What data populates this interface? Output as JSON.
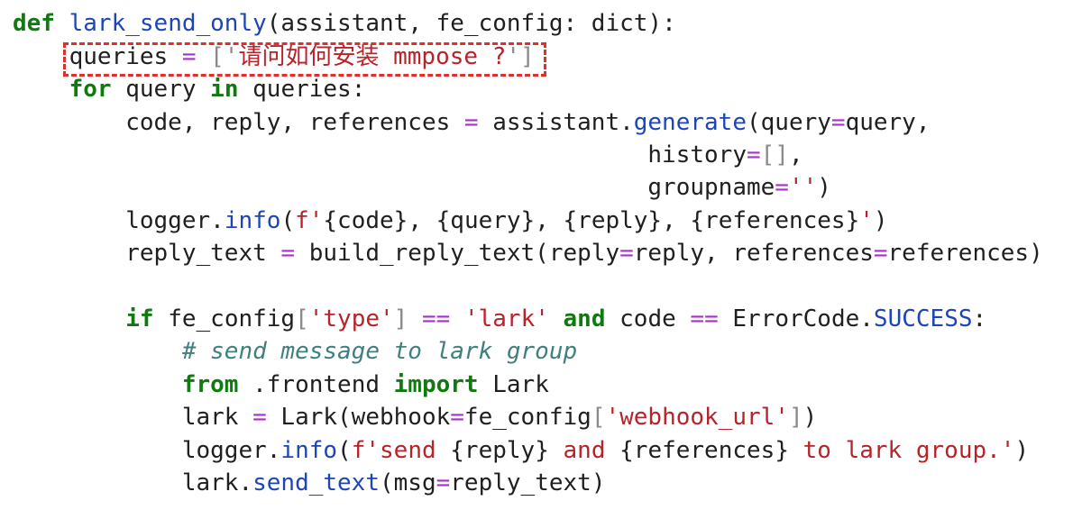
{
  "code": {
    "lines": [
      [
        {
          "t": "def",
          "c": "kw"
        },
        {
          "t": " "
        },
        {
          "t": "lark_send_only",
          "c": "fn"
        },
        {
          "t": "(assistant, fe_config: dict):"
        }
      ],
      [
        {
          "t": "    queries "
        },
        {
          "t": "=",
          "c": "op"
        },
        {
          "t": " "
        },
        {
          "t": "['",
          "c": "br"
        },
        {
          "t": "请问如何安装 mmpose ?",
          "c": "str"
        },
        {
          "t": "']",
          "c": "br"
        }
      ],
      [
        {
          "t": "    "
        },
        {
          "t": "for",
          "c": "kw"
        },
        {
          "t": " query "
        },
        {
          "t": "in",
          "c": "kw"
        },
        {
          "t": " queries:"
        }
      ],
      [
        {
          "t": "        code, reply, references "
        },
        {
          "t": "=",
          "c": "op"
        },
        {
          "t": " assistant."
        },
        {
          "t": "generate",
          "c": "fn"
        },
        {
          "t": "(query"
        },
        {
          "t": "=",
          "c": "op"
        },
        {
          "t": "query,"
        }
      ],
      [
        {
          "t": "                                             history"
        },
        {
          "t": "=",
          "c": "op"
        },
        {
          "t": "[]",
          "c": "br"
        },
        {
          "t": ","
        }
      ],
      [
        {
          "t": "                                             groupname"
        },
        {
          "t": "=",
          "c": "op"
        },
        {
          "t": "''",
          "c": "str"
        },
        {
          "t": ")"
        }
      ],
      [
        {
          "t": "        logger."
        },
        {
          "t": "info",
          "c": "fn"
        },
        {
          "t": "("
        },
        {
          "t": "f'",
          "c": "str"
        },
        {
          "t": "{code}, {query}, {reply}, {references}"
        },
        {
          "t": "'",
          "c": "str"
        },
        {
          "t": ")"
        }
      ],
      [
        {
          "t": "        reply_text "
        },
        {
          "t": "=",
          "c": "op"
        },
        {
          "t": " build_reply_text(reply"
        },
        {
          "t": "=",
          "c": "op"
        },
        {
          "t": "reply, references"
        },
        {
          "t": "=",
          "c": "op"
        },
        {
          "t": "references)"
        }
      ],
      [],
      [
        {
          "t": "        "
        },
        {
          "t": "if",
          "c": "kw"
        },
        {
          "t": " fe_config"
        },
        {
          "t": "[",
          "c": "br"
        },
        {
          "t": "'type'",
          "c": "str"
        },
        {
          "t": "]",
          "c": "br"
        },
        {
          "t": " "
        },
        {
          "t": "==",
          "c": "op"
        },
        {
          "t": " "
        },
        {
          "t": "'lark'",
          "c": "str"
        },
        {
          "t": " "
        },
        {
          "t": "and",
          "c": "kw"
        },
        {
          "t": " code "
        },
        {
          "t": "==",
          "c": "op"
        },
        {
          "t": " ErrorCode."
        },
        {
          "t": "SUCCESS",
          "c": "cst"
        },
        {
          "t": ":"
        }
      ],
      [
        {
          "t": "            "
        },
        {
          "t": "# send message to lark group",
          "c": "cm"
        }
      ],
      [
        {
          "t": "            "
        },
        {
          "t": "from",
          "c": "kw"
        },
        {
          "t": " .frontend "
        },
        {
          "t": "import",
          "c": "kw"
        },
        {
          "t": " Lark"
        }
      ],
      [
        {
          "t": "            lark "
        },
        {
          "t": "=",
          "c": "op"
        },
        {
          "t": " Lark(webhook"
        },
        {
          "t": "=",
          "c": "op"
        },
        {
          "t": "fe_config"
        },
        {
          "t": "[",
          "c": "br"
        },
        {
          "t": "'webhook_url'",
          "c": "str"
        },
        {
          "t": "]",
          "c": "br"
        },
        {
          "t": ")"
        }
      ],
      [
        {
          "t": "            logger."
        },
        {
          "t": "info",
          "c": "fn"
        },
        {
          "t": "("
        },
        {
          "t": "f'send ",
          "c": "str"
        },
        {
          "t": "{reply}"
        },
        {
          "t": " and ",
          "c": "str"
        },
        {
          "t": "{references}"
        },
        {
          "t": " to lark group.'",
          "c": "str"
        },
        {
          "t": ")"
        }
      ],
      [
        {
          "t": "            lark."
        },
        {
          "t": "send_text",
          "c": "fn"
        },
        {
          "t": "(msg"
        },
        {
          "t": "=",
          "c": "op"
        },
        {
          "t": "reply_text)"
        }
      ]
    ]
  },
  "colors": {
    "keyword": "#107a10",
    "function": "#1d45b8",
    "operator": "#a92fc9",
    "string": "#b8232a",
    "comment": "#3f7f7f",
    "highlight_border": "#e0302c"
  }
}
